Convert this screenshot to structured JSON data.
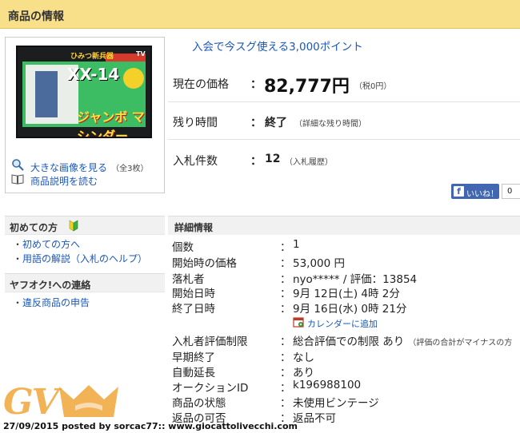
{
  "header": {
    "title": "商品の情報"
  },
  "image_box": {
    "packaging": {
      "top": "ひみつ新兵器",
      "main": "XX-14",
      "sub": "ジャンボ マシンダー",
      "tv": "TV"
    },
    "view_large": "大きな画像を見る",
    "image_count": "（全3枚）",
    "read_description": "商品説明を読む"
  },
  "promo": "入会で今スグ使える3,000ポイント",
  "price": {
    "label": "現在の価格",
    "colon": "：",
    "value": "82,777円",
    "tax": "（税0円）"
  },
  "time_left": {
    "label": "残り時間",
    "colon": "：",
    "value": "終了",
    "detail": "（詳細な残り時間）"
  },
  "bids": {
    "label": "入札件数",
    "colon": "：",
    "value": "12",
    "history": "（入札履歴）"
  },
  "like": {
    "label": "いいね！",
    "fb": "f",
    "count": "0"
  },
  "nav": {
    "beginners": {
      "title": "初めての方",
      "items": [
        "初めての方へ",
        "用語の解説（入札のヘルプ）"
      ]
    },
    "contact": {
      "title": "ヤフオク!への連絡",
      "items": [
        "違反商品の申告"
      ]
    }
  },
  "details": {
    "title": "詳細情報",
    "rows": [
      {
        "label": "個数",
        "colon": "：",
        "value": "1"
      },
      {
        "label": "開始時の価格",
        "colon": "：",
        "value": "53,000 円"
      },
      {
        "label": "落札者",
        "colon": "：",
        "value": "nyo***** / 評価：13854"
      },
      {
        "label": "開始日時",
        "colon": "：",
        "value": "9月 12日(土) 4時 2分"
      },
      {
        "label": "終了日時",
        "colon": "：",
        "value": "9月 16日(水) 0時 21分"
      },
      {
        "label": "入札者評価制限",
        "colon": "：",
        "value": "総合評価での制限 あり",
        "note": "（評価の合計がマイナスの方"
      },
      {
        "label": "早期終了",
        "colon": "：",
        "value": "なし"
      },
      {
        "label": "自動延長",
        "colon": "：",
        "value": "あり"
      },
      {
        "label": "オークションID",
        "colon": "：",
        "value": "k196988100"
      },
      {
        "label": "商品の状態",
        "colon": "：",
        "value": "未使用ビンテージ"
      },
      {
        "label": "返品の可否",
        "colon": "：",
        "value": "返品不可"
      }
    ],
    "calendar": "カレンダーに追加"
  },
  "watermark": "GV",
  "footer": "27/09/2015 posted by sorcac77:: www.giocattolivecchi.com"
}
